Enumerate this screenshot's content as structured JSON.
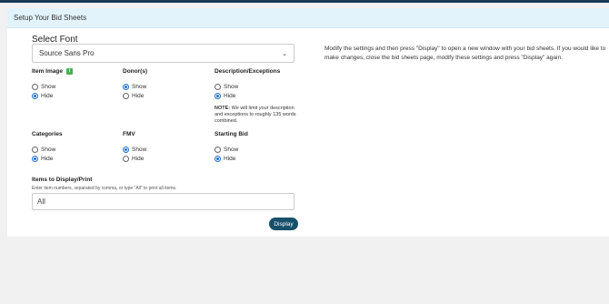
{
  "header": {
    "title": "Setup Your Bid Sheets"
  },
  "font": {
    "label": "Select Font",
    "selected": "Source Sans Pro"
  },
  "groups": [
    {
      "label": "Item Image",
      "show": "Show",
      "hide": "Hide",
      "selected": "hide",
      "info_badge": "i"
    },
    {
      "label": "Donor(s)",
      "show": "Show",
      "hide": "Hide",
      "selected": "show"
    },
    {
      "label": "Description/Exceptions",
      "show": "Show",
      "hide": "Hide",
      "selected": "hide"
    },
    {
      "label": "Categories",
      "show": "Show",
      "hide": "Hide",
      "selected": "hide"
    },
    {
      "label": "FMV",
      "show": "Show",
      "hide": "Hide",
      "selected": "show"
    },
    {
      "label": "Starting Bid",
      "show": "Show",
      "hide": "Hide",
      "selected": "hide"
    }
  ],
  "note": {
    "prefix": "NOTE:",
    "text": " We will limit your description and exceptions to roughly 135 words combined."
  },
  "items": {
    "label": "Items to Display/Print",
    "help": "Enter item numbers, separated by comma, or type \"All\" to print all items.",
    "value": "All"
  },
  "display_button": "Display",
  "instructions": "Modify the settings and then press \"Display\" to open a new window with your bid sheets. If you would like to make changes, close the bid sheets page, modify these settings and press \"Display\" again."
}
